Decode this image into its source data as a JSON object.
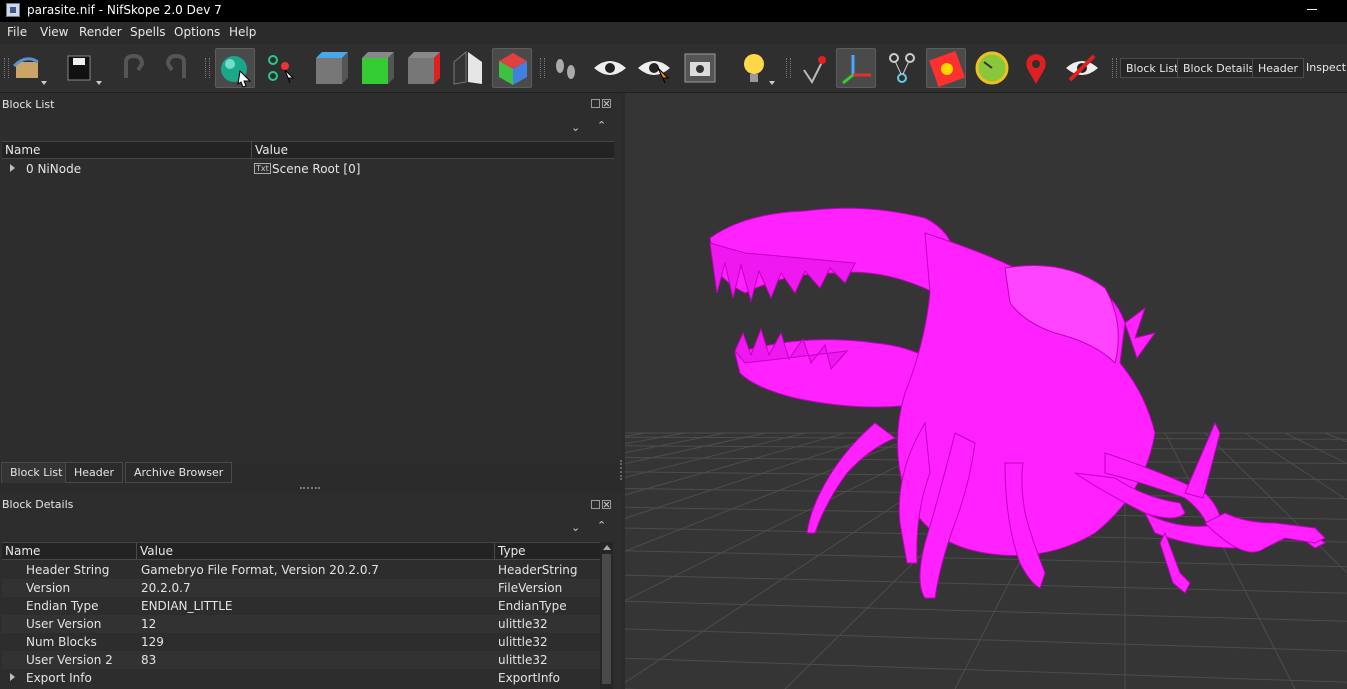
{
  "window": {
    "title": "parasite.nif - NifSkope 2.0 Dev 7"
  },
  "menu": {
    "items": [
      "File",
      "View",
      "Render",
      "Spells",
      "Options",
      "Help"
    ]
  },
  "toolbar": {
    "icons": [
      "load-icon",
      "save-icon",
      "undo-icon",
      "redo-icon",
      "select-mode-icon",
      "vertex-select-icon",
      "front-view-icon",
      "top-view-icon",
      "side-view-icon",
      "back-face-icon",
      "shaded-view-icon",
      "footprints-icon",
      "visibility-icon",
      "hidden-visibility-icon",
      "screenshot-icon",
      "lighting-icon",
      "pin-icon",
      "axes-icon",
      "nodes-icon",
      "texture-icon",
      "compass-icon",
      "marker-icon",
      "hide-icon"
    ],
    "dock_buttons": [
      "Block List",
      "Block Details",
      "Header",
      "Inspect"
    ]
  },
  "block_list": {
    "title": "Block List",
    "columns": [
      "Name",
      "Value"
    ],
    "rows": [
      {
        "name": "0 NiNode",
        "value": "Scene Root [0]"
      }
    ]
  },
  "tabs": [
    "Block List",
    "Header",
    "Archive Browser"
  ],
  "block_details": {
    "title": "Block Details",
    "columns": [
      "Name",
      "Value",
      "Type"
    ],
    "rows": [
      {
        "name": "Header String",
        "value": "Gamebryo File Format, Version 20.2.0.7",
        "type": "HeaderString"
      },
      {
        "name": "Version",
        "value": "20.2.0.7",
        "type": "FileVersion"
      },
      {
        "name": "Endian Type",
        "value": "ENDIAN_LITTLE",
        "type": "EndianType"
      },
      {
        "name": "User Version",
        "value": "12",
        "type": "ulittle32"
      },
      {
        "name": "Num Blocks",
        "value": "129",
        "type": "ulittle32"
      },
      {
        "name": "User Version 2",
        "value": "83",
        "type": "ulittle32"
      },
      {
        "name": "Export Info",
        "value": "",
        "type": "ExportInfo"
      }
    ]
  },
  "colors": {
    "model": "#ff22ff",
    "background": "#353535",
    "grid": "#4a4a4a"
  }
}
